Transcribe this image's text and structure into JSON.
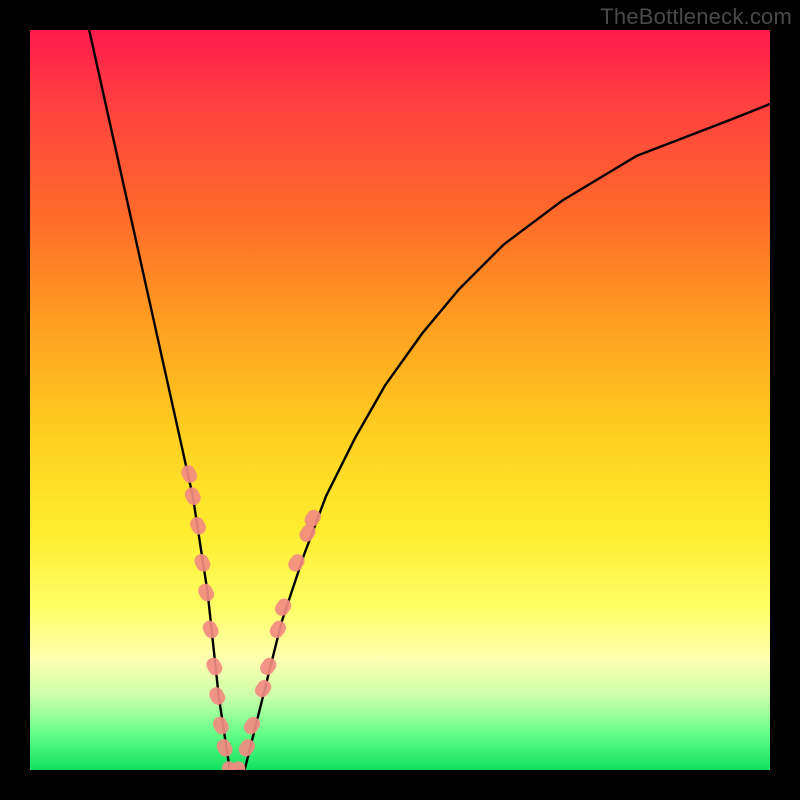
{
  "watermark": "TheBottleneck.com",
  "chart_data": {
    "type": "line",
    "title": "",
    "xlabel": "",
    "ylabel": "",
    "xlim": [
      0,
      100
    ],
    "ylim": [
      0,
      100
    ],
    "series": [
      {
        "name": "bottleneck-curve",
        "x": [
          8,
          10,
          12,
          14,
          16,
          18,
          20,
          22,
          24,
          25.5,
          27,
          28,
          29,
          30,
          32,
          34,
          37,
          40,
          44,
          48,
          53,
          58,
          64,
          72,
          82,
          95,
          100
        ],
        "values": [
          100,
          91,
          82,
          73,
          64,
          55,
          46,
          37,
          24,
          10,
          0,
          0,
          0,
          4,
          12,
          20,
          29,
          37,
          45,
          52,
          59,
          65,
          71,
          77,
          83,
          88,
          90
        ]
      }
    ],
    "markers": {
      "name": "highlighted-points",
      "color": "#f28b82",
      "points": [
        {
          "x": 21.5,
          "y": 40
        },
        {
          "x": 22,
          "y": 37
        },
        {
          "x": 22.7,
          "y": 33
        },
        {
          "x": 23.3,
          "y": 28
        },
        {
          "x": 23.8,
          "y": 24
        },
        {
          "x": 24.4,
          "y": 19
        },
        {
          "x": 24.9,
          "y": 14
        },
        {
          "x": 25.3,
          "y": 10
        },
        {
          "x": 25.8,
          "y": 6
        },
        {
          "x": 26.3,
          "y": 3
        },
        {
          "x": 27.0,
          "y": 0
        },
        {
          "x": 28.0,
          "y": 0
        },
        {
          "x": 29.3,
          "y": 3
        },
        {
          "x": 30.0,
          "y": 6
        },
        {
          "x": 31.5,
          "y": 11
        },
        {
          "x": 32.2,
          "y": 14
        },
        {
          "x": 33.5,
          "y": 19
        },
        {
          "x": 34.2,
          "y": 22
        },
        {
          "x": 36.0,
          "y": 28
        },
        {
          "x": 37.5,
          "y": 32
        },
        {
          "x": 38.2,
          "y": 34
        }
      ]
    },
    "background": {
      "type": "vertical-gradient",
      "stops": [
        {
          "pos": 0,
          "color": "#ff1a4d"
        },
        {
          "pos": 25,
          "color": "#ff6a2a"
        },
        {
          "pos": 55,
          "color": "#ffd020"
        },
        {
          "pos": 78,
          "color": "#ffff66"
        },
        {
          "pos": 100,
          "color": "#10e060"
        }
      ]
    }
  }
}
